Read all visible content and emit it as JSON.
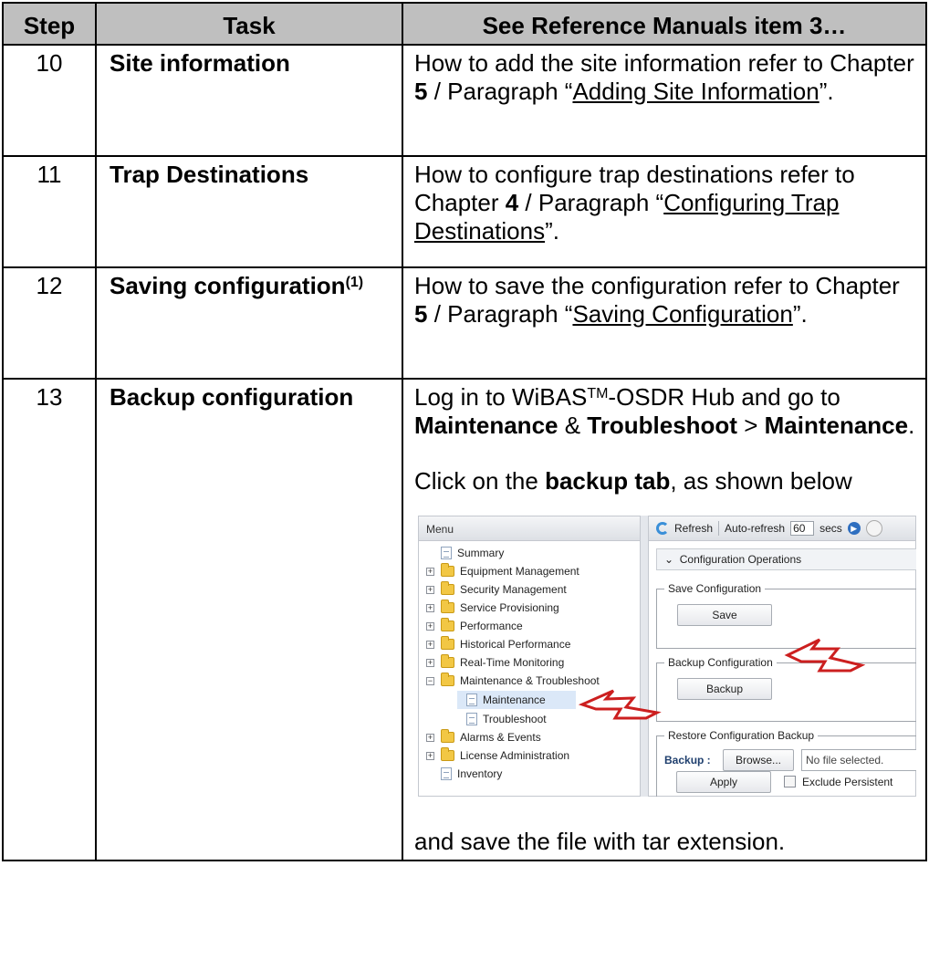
{
  "header": {
    "step": "Step",
    "task": "Task",
    "ref": "See Reference Manuals item 3…"
  },
  "rows": [
    {
      "step": "10",
      "task": "Site information",
      "desc_pre": "How to add the site information refer to Chapter ",
      "chapter": "5",
      "desc_mid": " / Paragraph “",
      "paragraph": "Adding Site Information",
      "desc_post": "”."
    },
    {
      "step": "11",
      "task": "Trap Destinations",
      "desc_pre": "How to configure trap destinations refer to Chapter ",
      "chapter": "4",
      "desc_mid": " / Paragraph “",
      "paragraph": "Configuring Trap Destinations",
      "desc_post": "”."
    },
    {
      "step": "12",
      "task": "Saving configuration",
      "task_sup": "(1)",
      "desc_pre": "How to save the configuration refer to Chapter ",
      "chapter": "5",
      "desc_mid": " / Paragraph “",
      "paragraph": "Saving Configuration",
      "desc_post": "”."
    }
  ],
  "row13": {
    "step": "13",
    "task": "Backup configuration",
    "line1_pre": "Log in to WiBAS",
    "line1_sup": "TM",
    "line1_post": "-OSDR Hub and go to ",
    "maintenance": "Maintenance",
    "amp": " & ",
    "troubleshoot": "Troubleshoot",
    "gt": " > ",
    "maintenance2": "Maintenance",
    "period": ".",
    "click_pre": "Click on the ",
    "backup_tab": "backup tab",
    "click_post": ", as shown below",
    "final": "and save the file with tar extension."
  },
  "screenshot": {
    "menu_title": "Menu",
    "menu_items": [
      {
        "label": "Summary",
        "kind": "page",
        "expander": ""
      },
      {
        "label": "Equipment Management",
        "kind": "folder",
        "expander": "+"
      },
      {
        "label": "Security Management",
        "kind": "folder",
        "expander": "+"
      },
      {
        "label": "Service Provisioning",
        "kind": "folder",
        "expander": "+"
      },
      {
        "label": "Performance",
        "kind": "folder",
        "expander": "+"
      },
      {
        "label": "Historical Performance",
        "kind": "folder",
        "expander": "+"
      },
      {
        "label": "Real-Time Monitoring",
        "kind": "folder",
        "expander": "+"
      },
      {
        "label": "Maintenance & Troubleshoot",
        "kind": "folder",
        "expander": "−"
      },
      {
        "label": "Maintenance",
        "kind": "page",
        "expander": "",
        "selected": true
      },
      {
        "label": "Troubleshoot",
        "kind": "page",
        "expander": ""
      },
      {
        "label": "Alarms & Events",
        "kind": "folder",
        "expander": "+"
      },
      {
        "label": "License Administration",
        "kind": "folder",
        "expander": "+"
      },
      {
        "label": "Inventory",
        "kind": "page",
        "expander": ""
      }
    ],
    "toolbar": {
      "refresh": "Refresh",
      "auto_refresh": "Auto-refresh",
      "seconds_value": "60",
      "secs": "secs"
    },
    "section": "Configuration Operations",
    "save_group": "Save Configuration",
    "save_button": "Save",
    "backup_group": "Backup Configuration",
    "backup_button": "Backup",
    "restore_group": "Restore Configuration Backup",
    "backup_label": "Backup :",
    "browse_button": "Browse...",
    "file_status": "No file selected.",
    "apply_button": "Apply",
    "exclude_label": "Exclude Persistent"
  }
}
